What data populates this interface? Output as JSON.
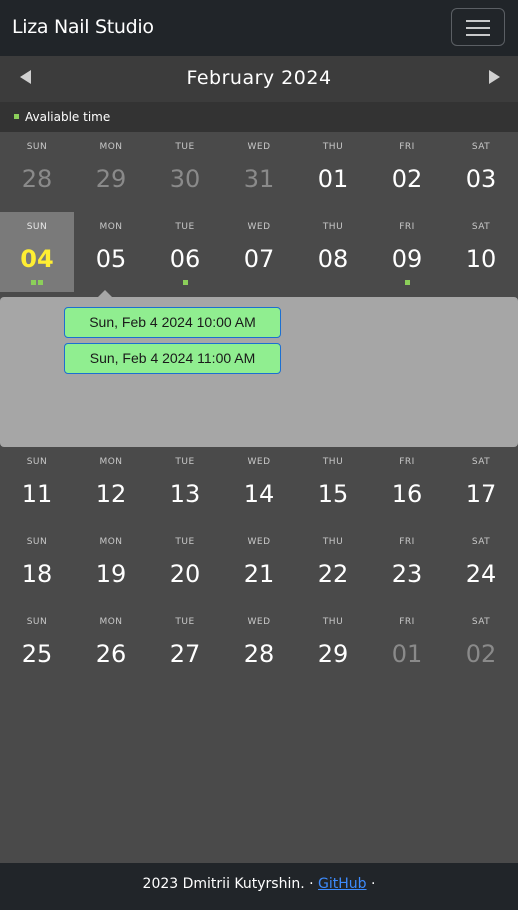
{
  "app": {
    "brand": "Liza Nail Studio"
  },
  "calendar": {
    "month_label": "February 2024",
    "legend_label": "Avaliable time",
    "weekday_labels": [
      "SUN",
      "MON",
      "TUE",
      "WED",
      "THU",
      "FRI",
      "SAT"
    ],
    "weeks": [
      [
        {
          "day": "28",
          "muted": true
        },
        {
          "day": "29",
          "muted": true
        },
        {
          "day": "30",
          "muted": true
        },
        {
          "day": "31",
          "muted": true
        },
        {
          "day": "01"
        },
        {
          "day": "02"
        },
        {
          "day": "03"
        }
      ],
      [
        {
          "day": "04",
          "selected": true,
          "available_dots": 2
        },
        {
          "day": "05"
        },
        {
          "day": "06",
          "available_dots": 1
        },
        {
          "day": "07"
        },
        {
          "day": "08"
        },
        {
          "day": "09",
          "available_dots": 1
        },
        {
          "day": "10"
        }
      ],
      [
        {
          "day": "11"
        },
        {
          "day": "12"
        },
        {
          "day": "13"
        },
        {
          "day": "14"
        },
        {
          "day": "15"
        },
        {
          "day": "16"
        },
        {
          "day": "17"
        }
      ],
      [
        {
          "day": "18"
        },
        {
          "day": "19"
        },
        {
          "day": "20"
        },
        {
          "day": "21"
        },
        {
          "day": "22"
        },
        {
          "day": "23"
        },
        {
          "day": "24"
        }
      ],
      [
        {
          "day": "25"
        },
        {
          "day": "26"
        },
        {
          "day": "27"
        },
        {
          "day": "28"
        },
        {
          "day": "29"
        },
        {
          "day": "01",
          "muted": true
        },
        {
          "day": "02",
          "muted": true
        }
      ]
    ],
    "time_slots": [
      "Sun, Feb 4 2024 10:00 AM",
      "Sun, Feb 4 2024 11:00 AM"
    ]
  },
  "footer": {
    "text": "2023 Dmitrii Kutyrshin. · ",
    "link_label": "GitHub",
    "suffix": " ·"
  },
  "colors": {
    "navbar_bg": "#212529",
    "page_bg": "#4a4a4a",
    "available_dot": "#8ccf5a",
    "selected_day_text": "#ffee33",
    "slot_bg": "#90ee90",
    "slot_border": "#1c6fd1",
    "link": "#3d8bfd"
  },
  "icons": {
    "menu": "hamburger-icon",
    "prev": "triangle-left-icon",
    "next": "triangle-right-icon"
  }
}
